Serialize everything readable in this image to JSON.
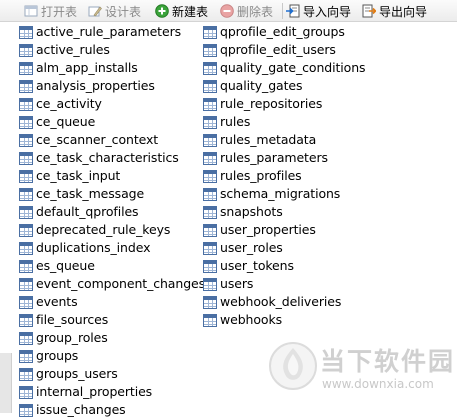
{
  "toolbar": {
    "open_table": "打开表",
    "design_table": "设计表",
    "new_table": "新建表",
    "delete_table": "删除表",
    "import_wizard": "导入向导",
    "export_wizard": "导出向导"
  },
  "tables": [
    "active_rule_parameters",
    "active_rules",
    "alm_app_installs",
    "analysis_properties",
    "ce_activity",
    "ce_queue",
    "ce_scanner_context",
    "ce_task_characteristics",
    "ce_task_input",
    "ce_task_message",
    "default_qprofiles",
    "deprecated_rule_keys",
    "duplications_index",
    "es_queue",
    "event_component_changes",
    "events",
    "file_sources",
    "group_roles",
    "groups",
    "groups_users",
    "internal_properties",
    "issue_changes",
    "qprofile_edit_groups",
    "qprofile_edit_users",
    "quality_gate_conditions",
    "quality_gates",
    "rule_repositories",
    "rules",
    "rules_metadata",
    "rules_parameters",
    "rules_profiles",
    "schema_migrations",
    "snapshots",
    "user_properties",
    "user_roles",
    "user_tokens",
    "users",
    "webhook_deliveries",
    "webhooks"
  ],
  "watermark": {
    "title": "当下软件园",
    "url": "www.downxia.com"
  }
}
